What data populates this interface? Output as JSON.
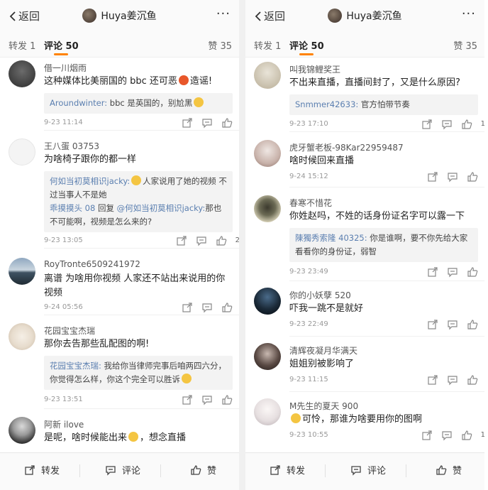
{
  "nav": {
    "back_label": "返回",
    "user_name": "Huya姜沉鱼",
    "more": "···"
  },
  "tabs": {
    "repost": "转发 1",
    "comments": "评论 50",
    "likes": "赞 35"
  },
  "bottom": {
    "repost": "转发",
    "comment": "评论",
    "like": "赞"
  },
  "left": [
    {
      "name": "借一川烟雨",
      "text": "这种媒体比美丽国的 bbc 还可恶",
      "text_after_emoji": "造谣!",
      "reply_name": "Aroundwinter:",
      "reply_text": " bbc 是英国的，别尬黑",
      "time": "9-23 11:14",
      "likes": ""
    },
    {
      "name": "王八蛋 03753",
      "text": "为啥椅子跟你的都一样",
      "reply_name": "何如当初莫相识jacky:",
      "reply_text": "人家说用了她的视频 不过当事人不是她",
      "reply2_name": "乖摸摸头 08",
      "reply2_mid": " 回复 ",
      "reply2_at": "@何如当初莫相识jacky:",
      "reply2_text": "那也不可能啊，视频是怎么来的?",
      "time": "9-23 13:05",
      "likes": "2"
    },
    {
      "name": "RoyTronte6509241972",
      "text": "离谱  为啥用你视频 人家还不站出来说用的你视频",
      "time": "9-24 05:56",
      "likes": ""
    },
    {
      "name": "花园宝宝杰瑞",
      "text": "那你去告那些乱配图的啊!",
      "reply_name": "花园宝宝杰瑞:",
      "reply_text": " 我给你当律师完事后咱两四六分，你觉得怎么样，你这个完全可以胜诉",
      "time": "9-23 13:51",
      "likes": ""
    },
    {
      "name": "阿新 ilove",
      "text": "是呢，啥时候能出来",
      "text_after_emoji": "，想念直播",
      "time": "",
      "likes": ""
    }
  ],
  "right": [
    {
      "name": "叫我锦鲤奖王",
      "text": "不出来直播，直播间封了，又是什么原因?",
      "reply_name": "Snmmer42633:",
      "reply_text": " 官方怕带节奏",
      "time": "9-23 17:10",
      "likes": "1"
    },
    {
      "name": "虎牙蟹老板-98Kar22959487",
      "text": "啥时候回来直播",
      "time": "9-24 15:12",
      "likes": ""
    },
    {
      "name": "春寒不惜花",
      "text": "你姓赵吗，不姓的话身份证名字可以露一下",
      "reply_name": "陳獨秀索隆 40325:",
      "reply_text": " 你是谁啊，要不你先给大家看看你的身份证，弱智",
      "time": "9-23 23:49",
      "likes": ""
    },
    {
      "name": "你的小妖孽 520",
      "text": "吓我一跳不是就好",
      "time": "9-23 22:49",
      "likes": ""
    },
    {
      "name": "清辉夜凝月华满天",
      "text": "姐姐别被影响了",
      "time": "9-23 11:15",
      "likes": ""
    },
    {
      "name": "M先生的夏天 900",
      "text": "可怜，那谁为啥要用你的图啊",
      "time": "9-23 10:55",
      "likes": "1"
    }
  ]
}
